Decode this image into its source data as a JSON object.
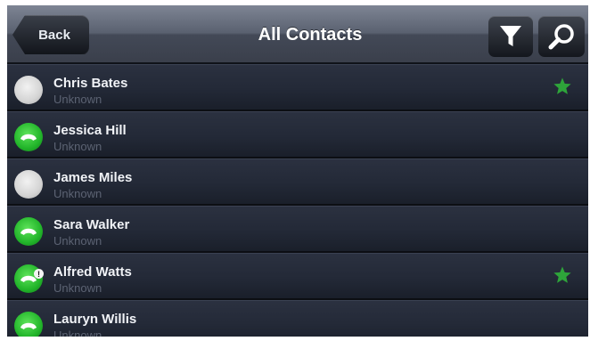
{
  "header": {
    "back_label": "Back",
    "title": "All Contacts",
    "filter_icon": "filter-icon",
    "search_icon": "search-icon"
  },
  "colors": {
    "online": "#22b52a",
    "offline": "#d4d4d4",
    "favorite_star": "#2ea43a"
  },
  "contacts": [
    {
      "name": "Chris Bates",
      "status": "Unknown",
      "presence": "offline",
      "favorite": true
    },
    {
      "name": "Jessica Hill",
      "status": "Unknown",
      "presence": "online",
      "favorite": false
    },
    {
      "name": "James Miles",
      "status": "Unknown",
      "presence": "offline",
      "favorite": false
    },
    {
      "name": "Sara Walker",
      "status": "Unknown",
      "presence": "online",
      "favorite": false
    },
    {
      "name": "Alfred Watts",
      "status": "Unknown",
      "presence": "online",
      "favorite": true,
      "badge": "!"
    },
    {
      "name": "Lauryn Willis",
      "status": "Unknown",
      "presence": "online",
      "favorite": false
    }
  ]
}
